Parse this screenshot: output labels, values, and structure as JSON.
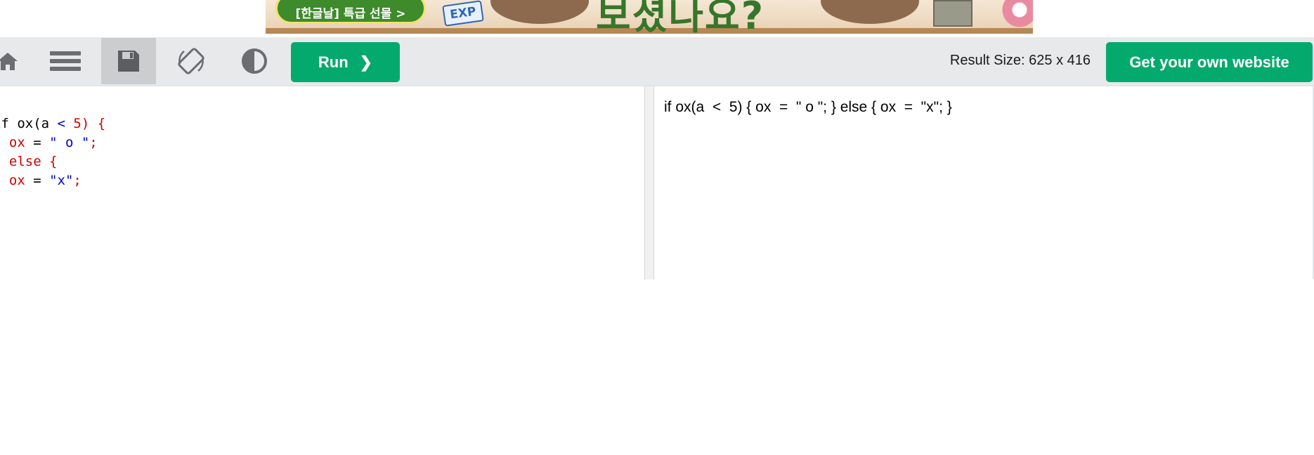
{
  "ad": {
    "button_label": "[한글날] 특급 선물 >",
    "badge": "EXP",
    "headline": "보셨나요?"
  },
  "toolbar": {
    "icons": [
      "home-icon",
      "menu-icon",
      "save-icon",
      "rotate-icon",
      "contrast-icon"
    ],
    "run_label": "Run",
    "run_chevron": "❯",
    "result_size": "Result Size: 625 x 416",
    "get_website_label": "Get your own website",
    "accent_color": "#04aa6d"
  },
  "editor": {
    "lines": [
      [
        {
          "t": "if ox(a ",
          "c": "plain"
        },
        {
          "t": "<",
          "c": "blue"
        },
        {
          "t": " 5) {",
          "c": "red"
        }
      ],
      [
        {
          "t": "  ox",
          "c": "red"
        },
        {
          "t": " = ",
          "c": "plain"
        },
        {
          "t": "\" o \"",
          "c": "blue"
        },
        {
          "t": ";",
          "c": "red"
        }
      ],
      [
        {
          "t": "} else {",
          "c": "red"
        }
      ],
      [
        {
          "t": "  ox",
          "c": "red"
        },
        {
          "t": " = ",
          "c": "plain"
        },
        {
          "t": "\"x\"",
          "c": "blue"
        },
        {
          "t": ";",
          "c": "red"
        }
      ],
      [
        {
          "t": "}",
          "c": "red"
        }
      ]
    ],
    "colors": {
      "plain": "#000000",
      "red": "#d00000",
      "blue": "#0000cd"
    }
  },
  "result": {
    "text": "if ox(a  <  5) { ox  =  \" o \"; } else { ox  =  \"x\"; }"
  }
}
